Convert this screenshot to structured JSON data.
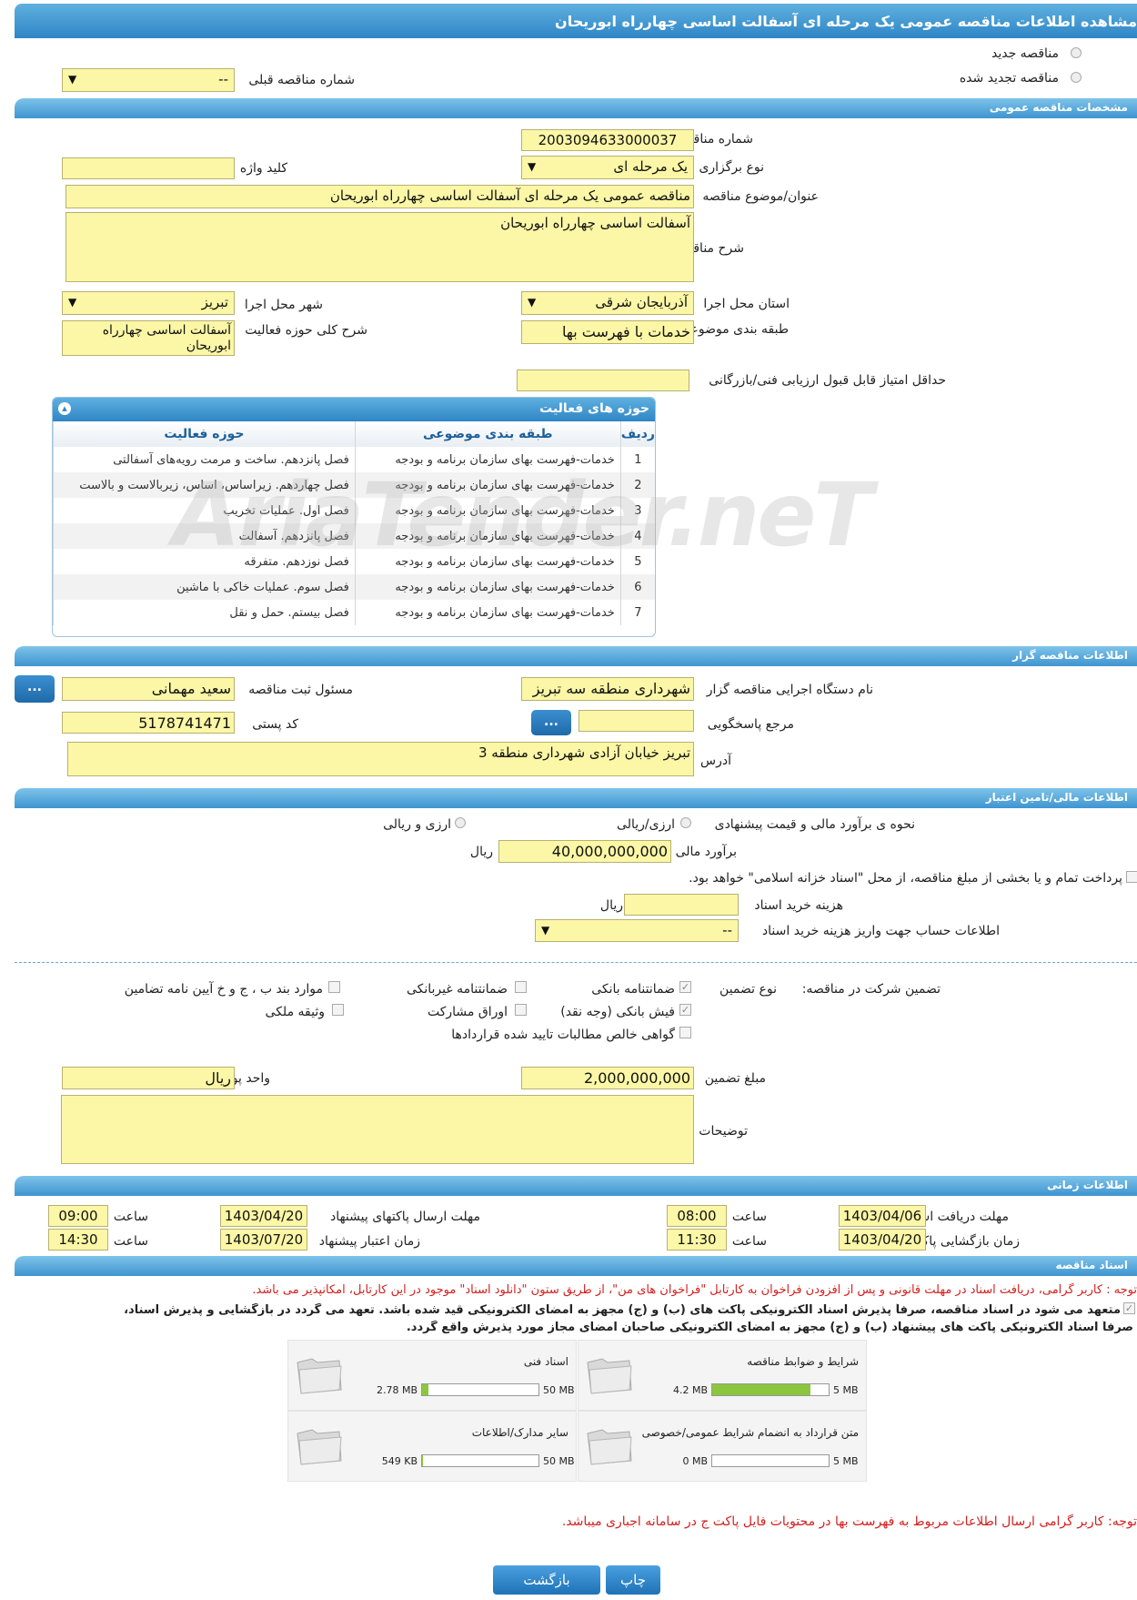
{
  "page_title": "مشاهده اطلاعات مناقصه عمومی یک مرحله ای آسفالت اساسی چهارراه ابوریحان",
  "tender_type": {
    "new_label": "مناقصه جدید",
    "renewed_label": "مناقصه تجدید شده",
    "prev_label": "شماره مناقصه قبلی",
    "prev_value": "--"
  },
  "general": {
    "header": "مشخصات مناقصه عمومی",
    "number_label": "شماره مناقصه",
    "number": "2003094633000037",
    "holding_type_label": "نوع برگزاری",
    "holding_type": "یک مرحله ای",
    "keyword_label": "کلید واژه",
    "keyword": "",
    "subject_label": "عنوان/موضوع مناقصه",
    "subject": "مناقصه عمومی یک مرحله ای آسفالت اساسی چهارراه ابوریحان",
    "desc_label": "شرح مناقصه",
    "desc": "آسفالت اساسی چهارراه ابوریحان",
    "province_label": "استان محل اجرا",
    "province": "آذربایجان شرقی",
    "city_label": "شهر محل اجرا",
    "city": "تبریز",
    "category_label": "طبقه بندی موضوعی",
    "category": "خدمات با فهرست بها",
    "scope_desc_label": "شرح کلی حوزه فعالیت",
    "scope_desc": "آسفالت اساسی چهارراه ابوریحان",
    "min_score_label": "حداقل امتیاز قابل قبول ارزیابی فنی/بازرگانی",
    "min_score": ""
  },
  "activities": {
    "header": "حوزه های فعالیت",
    "col_row": "ردیف",
    "col_cat": "طبقه بندی موضوعی",
    "col_scope": "حوزه فعالیت",
    "rows": [
      {
        "n": "1",
        "cat": "خدمات-فهرست بهای سازمان برنامه و بودجه",
        "scope": "فصل پانزدهم. ساخت و مرمت رویه‌های آسفالتی"
      },
      {
        "n": "2",
        "cat": "خدمات-فهرست بهای سازمان برنامه و بودجه",
        "scope": "فصل چهاردهم. زیراساس، اساس، زیربالاست و بالاست"
      },
      {
        "n": "3",
        "cat": "خدمات-فهرست بهای سازمان برنامه و بودجه",
        "scope": "فصل اول. عملیات تخریب"
      },
      {
        "n": "4",
        "cat": "خدمات-فهرست بهای سازمان برنامه و بودجه",
        "scope": "فصل پانزدهم. آسفالت"
      },
      {
        "n": "5",
        "cat": "خدمات-فهرست بهای سازمان برنامه و بودجه",
        "scope": "فصل نوزدهم. متفرقه"
      },
      {
        "n": "6",
        "cat": "خدمات-فهرست بهای سازمان برنامه و بودجه",
        "scope": "فصل سوم. عملیات خاکی با ماشین"
      },
      {
        "n": "7",
        "cat": "خدمات-فهرست بهای سازمان برنامه و بودجه",
        "scope": "فصل بیستم. حمل و نقل"
      }
    ]
  },
  "organizer": {
    "header": "اطلاعات مناقصه گزار",
    "org_label": "نام دستگاه اجرایی مناقصه گزار",
    "org": "شهرداری منطقه سه تبریز",
    "resp_label": "مسئول ثبت مناقصه",
    "resp": "سعید مهمانی",
    "ref_label": "مرجع پاسخگویی",
    "ref": "",
    "postal_label": "کد پستی",
    "postal": "5178741471",
    "address_label": "آدرس",
    "address": "تبریز خیابان آزادی شهرداری منطقه 3",
    "dots": "..."
  },
  "finance": {
    "header": "اطلاعات مالی/تامین اعتبار",
    "method_label": "نحوه ی برآورد مالی و قیمت پیشنهادی",
    "opt1": "ارزی/ریالی",
    "opt2": "ارزی و ریالی",
    "estimate_label": "برآورد مالی",
    "estimate": "40,000,000,000",
    "rial": "ریال",
    "treasury_text": "پرداخت تمام و یا بخشی از مبلغ مناقصه، از محل \"اسناد خزانه اسلامی\" خواهد بود.",
    "doc_cost_label": "هزینه خرید اسناد",
    "doc_cost": "",
    "doc_cost_unit": "ریال",
    "account_label": "اطلاعات حساب جهت واریز هزینه خرید اسناد",
    "account": "--"
  },
  "guarantee": {
    "label": "تضمین شرکت در مناقصه:",
    "type_label": "نوع تضمین",
    "bank": "ضمانتنامه بانکی",
    "nonbank": "ضمانتنامه غیربانکی",
    "items_bpj": "موارد بند ب ، ج و خ آیین نامه تضامین",
    "cash": "فیش بانکی (وجه نقد)",
    "bonds": "اوراق مشارکت",
    "property": "وثیقه ملکی",
    "receivable": "گواهی خالص مطالبات تایید شده قراردادها",
    "amount_label": "مبلغ تضمین",
    "amount": "2,000,000,000",
    "currency_label": "واحد پول",
    "currency": "ریال",
    "notes_label": "توضیحات",
    "notes": ""
  },
  "timing": {
    "header": "اطلاعات زمانی",
    "doc_receive_label": "مهلت دریافت اسناد",
    "doc_receive": "1403/04/06",
    "time_label": "ساعت",
    "doc_receive_time": "08:00",
    "send_label": "مهلت ارسال پاکتهای پیشنهاد",
    "send": "1403/04/20",
    "send_time": "09:00",
    "open_label": "زمان بازگشایی پاکت ها",
    "open": "1403/04/20",
    "open_time": "11:30",
    "valid_label": "زمان اعتبار پیشنهاد",
    "valid": "1403/07/20",
    "valid_time": "14:30"
  },
  "docs": {
    "header": "اسناد مناقصه",
    "note1": "توجه : کاربر گرامی، دریافت اسناد در مهلت قانونی و پس از افزودن فراخوان به کارتابل \"فراخوان های من\"، از طریق ستون \"دانلود اسناد\" موجود در این کارتابل، امکانپذیر می باشد.",
    "note2a": "متعهد می شود در اسناد مناقصه، صرفاً پذیرش اسناد الکترونیکی پاکت های (ب) و (ج) مجهز به امضای الکترونیکی قید شده باشد. تعهد می گردد در بازگشایی و پذیرش اسناد،",
    "note2b": "صرفاً اسناد الکترونیکی پاکت های پیشنهاد (ب) و (ج) مجهز به امضای الکترونیکی صاحبان امضای مجاز مورد پذیرش واقع گردد.",
    "files": [
      {
        "title": "شرایط و ضوابط مناقصه",
        "size": "4.2 MB",
        "max": "5 MB",
        "fraction": 0.84
      },
      {
        "title": "اسناد فنی",
        "size": "2.78 MB",
        "max": "50 MB",
        "fraction": 0.056
      },
      {
        "title": "متن قرارداد به انضمام شرایط عمومی/خصوصی",
        "size": "0 MB",
        "max": "5 MB",
        "fraction": 0
      },
      {
        "title": "سایر مدارک/اطلاعات",
        "size": "549 KB",
        "max": "50 MB",
        "fraction": 0.011
      }
    ],
    "note3": "توجه: کاربر گرامی ارسال اطلاعات مربوط به فهرست بها در محتویات فایل پاکت ج در سامانه اجباری میباشد."
  },
  "footer": {
    "back": "بازگشت",
    "print": "چاپ"
  },
  "watermark": "AriaTender.neT"
}
